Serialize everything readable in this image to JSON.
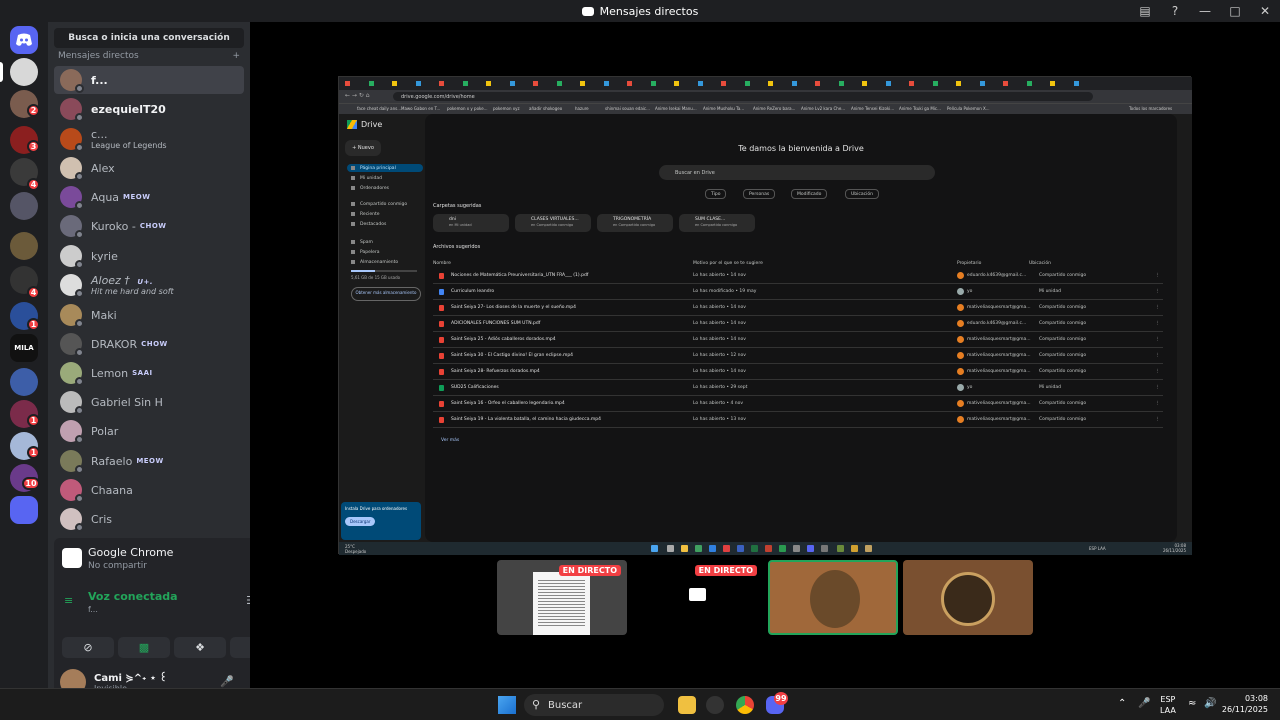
{
  "window": {
    "title": "Mensajes directos"
  },
  "servers": {
    "badges": [
      "2",
      "3",
      "4",
      "4",
      "1",
      "1",
      "1",
      "10"
    ],
    "mila_label": "MILA"
  },
  "dm_list": {
    "search_placeholder": "Busca o inicia una conversación",
    "header": "Mensajes directos",
    "add_symbol": "+",
    "items": [
      {
        "name": "f..."
      },
      {
        "name": "ezequielT20"
      },
      {
        "name": "c...",
        "sub": "League of Legends"
      },
      {
        "name": "Alex"
      },
      {
        "name": "Aqua",
        "tag": "MEOW"
      },
      {
        "name": "Kuroko -",
        "tag": "CHOW"
      },
      {
        "name": "kyrie"
      },
      {
        "name": "Aloez † ",
        "tag": "U+.",
        "sub": "Hit me hard and soft"
      },
      {
        "name": "Maki"
      },
      {
        "name": "DRAKOR",
        "tag": "CHOW"
      },
      {
        "name": "Lemon",
        "tag": "SAAI"
      },
      {
        "name": "Gabriel Sin H"
      },
      {
        "name": "Polar"
      },
      {
        "name": "Rafaelo",
        "tag": "MEOW"
      },
      {
        "name": "Chaana"
      },
      {
        "name": "Cris"
      }
    ]
  },
  "voice_panel": {
    "stream_title": "Google Chrome",
    "stream_sub": "No compartir",
    "connected": "Voz conectada",
    "channel": "f..."
  },
  "user": {
    "name": "Cami ⋟^˖ ⋆ ꒰",
    "status": "Invisible"
  },
  "stream": {
    "tabs_label": "Tabs",
    "url": "drive.google.com/drive/home",
    "bookmarks": [
      "face cheat daily ans...",
      "Mawo Gabon en T...",
      "pokemon x y poke...",
      "pokemon xyz",
      "añadir shokogeo",
      "hazure",
      "shinmai souan edaic...",
      "Anime Isekai Manu...",
      "Anime Mushoku Ta...",
      "Anime ReZero bara...",
      "Anime Lv2 kara Che...",
      "Anime Tensei Kizoki...",
      "Anime Tsuki ga Mic...",
      "Película Pokemon X...",
      "Todos los marcadores"
    ],
    "drive": {
      "logo": "Drive",
      "new": "Nuevo",
      "nav": [
        "Página principal",
        "Mi unidad",
        "Ordenadores",
        "Compartido conmigo",
        "Reciente",
        "Destacados",
        "Spam",
        "Papelera",
        "Almacenamiento"
      ],
      "storage": "5,61 GB de 15 GB usado",
      "get_more": "Obtener más almacenamiento",
      "welcome": "Te damos la bienvenida a Drive",
      "search": "Buscar en Drive",
      "chips": [
        "Tipo",
        "Personas",
        "Modificado",
        "Ubicación"
      ],
      "folders_title": "Carpetas sugeridas",
      "folders": [
        {
          "name": "dni",
          "sub": "en Mi unidad"
        },
        {
          "name": "CLASES VIRTUALES...",
          "sub": "en Compartido conmigo"
        },
        {
          "name": "TRIGONOMETRÍA",
          "sub": "en Compartido conmigo"
        },
        {
          "name": "SUM CLASE...",
          "sub": "en Compartido conmigo"
        }
      ],
      "files_title": "Archivos sugeridos",
      "columns": [
        "Nombre",
        "Motivo por el que se te sugiere",
        "Propietario",
        "Ubicación"
      ],
      "files": [
        {
          "name": "Nociones de Matemática Preuniversitaria_UTN FRA___ (1).pdf",
          "reason": "Lo has abierto • 14 nov",
          "owner": "eduardo.k4639@gmail.c...",
          "loc": "Compartido conmigo",
          "color": "#e94235"
        },
        {
          "name": "Curriculum leandro",
          "reason": "Lo has modificado • 19 may",
          "owner": "yo",
          "loc": "Mi unidad",
          "color": "#4285f4"
        },
        {
          "name": "Saint Seiya 27- Los dioses de la muerte y el sueño.mp4",
          "reason": "Lo has abierto • 14 nov",
          "owner": "mativeliasquesmart@gma...",
          "loc": "Compartido conmigo",
          "color": "#e94235"
        },
        {
          "name": "ADICIONALES FUNCIONES SUM UTN.pdf",
          "reason": "Lo has abierto • 14 nov",
          "owner": "eduardo.k4639@gmail.c...",
          "loc": "Compartido conmigo",
          "color": "#e94235"
        },
        {
          "name": "Saint Seiya 25 - Adiós caballeros dorados.mp4",
          "reason": "Lo has abierto • 14 nov",
          "owner": "mativeliasquesmart@gma...",
          "loc": "Compartido conmigo",
          "color": "#e94235"
        },
        {
          "name": "Saint Seiya 30 - El Castigo divino! El gran eclipse.mp4",
          "reason": "Lo has abierto • 12 nov",
          "owner": "mativeliasquesmart@gma...",
          "loc": "Compartido conmigo",
          "color": "#e94235"
        },
        {
          "name": "Saint Seiya 28- Refuerzos dorados.mp4",
          "reason": "Lo has abierto • 14 nov",
          "owner": "mativeliasquesmart@gma...",
          "loc": "Compartido conmigo",
          "color": "#e94235"
        },
        {
          "name": "SUD25 Calificaciones",
          "reason": "Lo has abierto • 29 sept",
          "owner": "yo",
          "loc": "Mi unidad",
          "color": "#0f9d58"
        },
        {
          "name": "Saint Seiya 16 - Orfeo el caballero legendario.mp4",
          "reason": "Lo has abierto • 4 nov",
          "owner": "mativeliasquesmart@gma...",
          "loc": "Compartido conmigo",
          "color": "#e94235"
        },
        {
          "name": "Saint Seiya 19 - La violenta batalla, el camino hacia giudecca.mp4",
          "reason": "Lo has abierto • 13 nov",
          "owner": "mativeliasquesmart@gma...",
          "loc": "Compartido conmigo",
          "color": "#e94235"
        }
      ],
      "see_more": "Ver más",
      "install_text": "Instala Drive para ordenadores",
      "install_btn": "Descargar"
    },
    "task_temp": "25°C",
    "task_weather": "Despejado",
    "task_time": "03:08",
    "task_date": "26/11/2025",
    "task_lang": "ESP LAA"
  },
  "tiles": {
    "live_label": "EN DIRECTO"
  },
  "taskbar": {
    "search": "Buscar",
    "lang1": "ESP",
    "lang2": "LAA",
    "time": "03:08",
    "date": "26/11/2025",
    "discord_badge": "99"
  }
}
